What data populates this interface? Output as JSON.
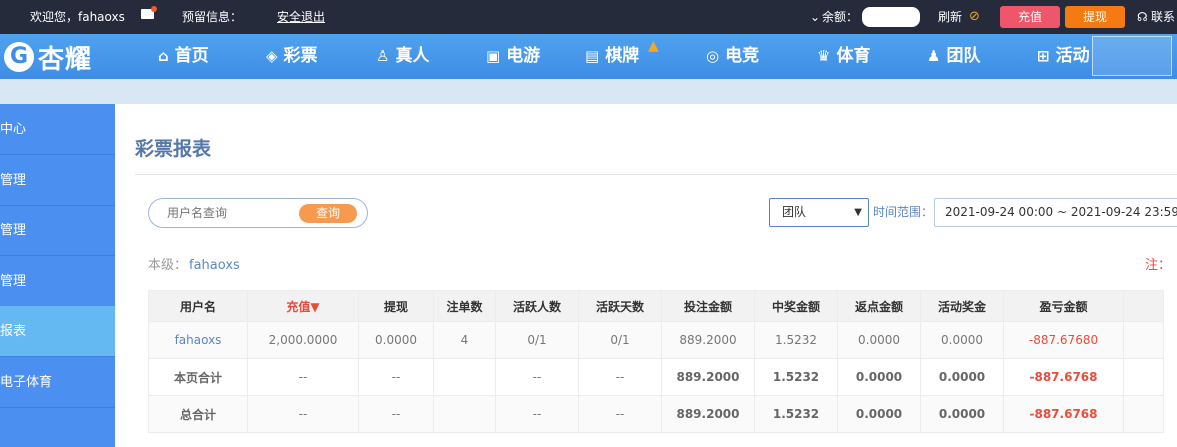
{
  "topbar": {
    "welcome": "欢迎您，fahaoxs",
    "reserved_label": "预留信息：",
    "logout": "安全退出",
    "balance_label": "余额：",
    "refresh": "刷新",
    "recharge": "充值",
    "withdraw": "提现",
    "contact": "联系"
  },
  "brand": {
    "logo_text": "杏耀"
  },
  "nav": [
    {
      "label": "首页",
      "icon": "home-icon"
    },
    {
      "label": "彩票",
      "icon": "lottery-icon"
    },
    {
      "label": "真人",
      "icon": "live-icon"
    },
    {
      "label": "电游",
      "icon": "slots-icon"
    },
    {
      "label": "棋牌",
      "icon": "cards-icon"
    },
    {
      "label": "电竞",
      "icon": "gamepad-icon"
    },
    {
      "label": "体育",
      "icon": "trophy-icon"
    },
    {
      "label": "团队",
      "icon": "team-icon"
    },
    {
      "label": "活动",
      "icon": "gift-icon"
    }
  ],
  "sidebar": [
    {
      "label": "中心"
    },
    {
      "label": "管理"
    },
    {
      "label": "管理"
    },
    {
      "label": "管理"
    },
    {
      "label": "报表"
    },
    {
      "label": "电子体育"
    }
  ],
  "main": {
    "title": "彩票报表",
    "search_placeholder": "用户名查询",
    "search_button": "查询",
    "select_value": "团队",
    "range_label": "时间范围：",
    "range_value": "2021-09-24 00:00 ~ 2021-09-24 23:59",
    "level_label": "本级：",
    "level_user": "fahaoxs",
    "note": "注："
  },
  "table": {
    "headers": [
      "用户名",
      "充值▼",
      "提现",
      "注单数",
      "活跃人数",
      "活跃天数",
      "投注金额",
      "中奖金额",
      "返点金额",
      "活动奖金",
      "盈亏金额",
      ""
    ],
    "rows": [
      [
        "fahaoxs",
        "2,000.0000",
        "0.0000",
        "4",
        "0/1",
        "0/1",
        "889.2000",
        "1.5232",
        "0.0000",
        "0.0000",
        "-887.67680",
        ""
      ],
      [
        "本页合计",
        "--",
        "--",
        "",
        "--",
        "--",
        "889.2000",
        "1.5232",
        "0.0000",
        "0.0000",
        "-887.6768",
        ""
      ],
      [
        "总合计",
        "--",
        "--",
        "",
        "--",
        "--",
        "889.2000",
        "1.5232",
        "0.0000",
        "0.0000",
        "-887.6768",
        ""
      ]
    ]
  },
  "colors": {
    "topbar": "#252b3b",
    "nav": "#3e8de6",
    "sidebar": "#4b8ff0",
    "sidebar_active": "#65b9f3",
    "negative": "#e84c3d"
  }
}
